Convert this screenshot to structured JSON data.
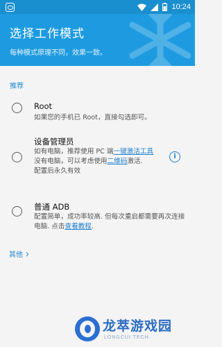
{
  "status_bar": {
    "time": "10:24"
  },
  "header": {
    "title": "选择工作模式",
    "subtitle": "每种模式原理不同，效果一致。"
  },
  "section": {
    "label": "推荐"
  },
  "options": [
    {
      "title": "Root",
      "desc": "如果您的手机已 Root，直接勾选即可。"
    },
    {
      "title": "设备管理员",
      "desc_line1_pre": "如有电脑，推荐使用 PC 端",
      "desc_line1_link": "一键激活工具",
      "desc_line2_pre": "没有电脑，可以考虑使用",
      "desc_line2_link": "二维码",
      "desc_line2_post": "激活.",
      "desc_line3": "配置后永久有效"
    },
    {
      "title": "普通 ADB",
      "desc_pre": "配置简单，成功率较高. 但每次重启都需要再次连接电脑. 点击",
      "desc_link": "查看教程",
      "desc_post": "."
    }
  ],
  "other": {
    "label": "其他"
  },
  "watermark": {
    "text": "龙萃游戏园",
    "sub": "LONGCUI TECH"
  },
  "colors": {
    "header": "#1e9be0",
    "status_bar": "#1a8fcf",
    "accent": "#1e88d0"
  }
}
